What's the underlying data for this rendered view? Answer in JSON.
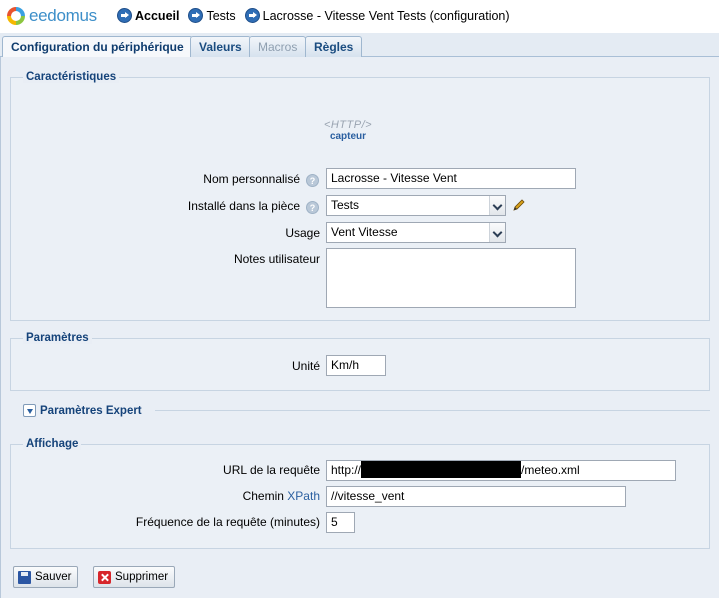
{
  "app": {
    "logo_text": "eedomus"
  },
  "breadcrumb": [
    {
      "label": "Accueil"
    },
    {
      "label": "Tests"
    },
    {
      "label": "Lacrosse - Vitesse Vent Tests (configuration)"
    }
  ],
  "tabs": [
    {
      "label": "Configuration du périphérique",
      "state": "active"
    },
    {
      "label": "Valeurs",
      "state": "normal"
    },
    {
      "label": "Macros",
      "state": "disabled"
    },
    {
      "label": "Règles",
      "state": "normal"
    }
  ],
  "caracteristiques": {
    "legend": "Caractéristiques",
    "device_icon": {
      "word": "<HTTP/>",
      "caption": "capteur"
    },
    "nom_label": "Nom personnalisé",
    "nom_value": "Lacrosse - Vitesse Vent",
    "piece_label": "Installé dans la pièce",
    "piece_value": "Tests",
    "usage_label": "Usage",
    "usage_value": "Vent Vitesse",
    "notes_label": "Notes utilisateur",
    "notes_value": ""
  },
  "parametres": {
    "legend": "Paramètres",
    "unite_label": "Unité",
    "unite_value": "Km/h"
  },
  "expert": {
    "label": "Paramètres Expert"
  },
  "affichage": {
    "legend": "Affichage",
    "url_label": "URL de la requête",
    "url_prefix": "http://",
    "url_suffix": "/meteo.xml",
    "chemin_label": "Chemin",
    "xpath_link": "XPath",
    "chemin_value": "//vitesse_vent",
    "freq_label": "Fréquence de la requête (minutes)",
    "freq_value": "5"
  },
  "actions": {
    "save": "Sauver",
    "delete": "Supprimer"
  },
  "colors": {
    "accent": "#15437a",
    "background": "#e9eef5",
    "delete": "#d7262b"
  },
  "icons": [
    "logo-icon",
    "arrow-circle-icon",
    "help-icon",
    "chevron-down-icon",
    "pencil-icon",
    "expand-toggle-icon",
    "save-icon",
    "delete-icon"
  ]
}
